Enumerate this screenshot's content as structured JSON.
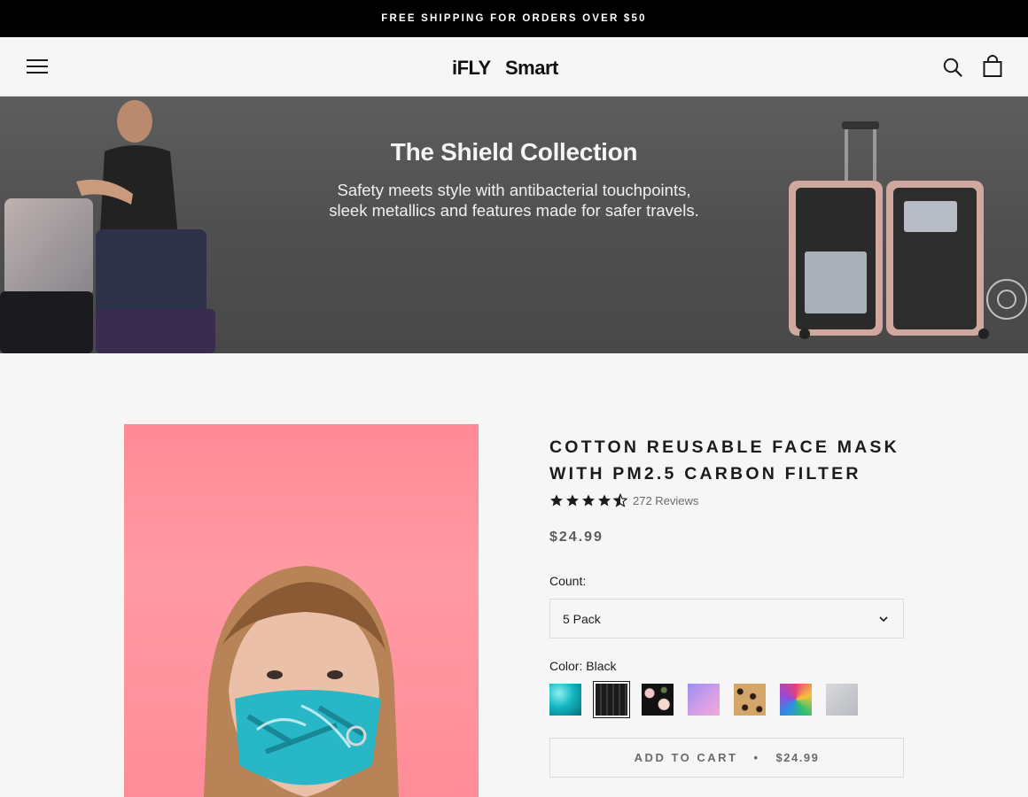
{
  "announcement": "FREE SHIPPING FOR ORDERS OVER $50",
  "brand": {
    "logo_text": "iFLYSmart"
  },
  "hero": {
    "title": "The Shield Collection",
    "subtitle_line1": "Safety meets style with antibacterial touchpoints,",
    "subtitle_line2": "sleek metallics and features made for safer travels."
  },
  "product": {
    "title": "COTTON REUSABLE FACE MASK WITH PM2.5 CARBON FILTER",
    "rating": 4.5,
    "reviews_label": "272 Reviews",
    "price": "$24.99",
    "count_label": "Count:",
    "count_value": "5 Pack",
    "color_label": "Color:",
    "color_value": "Black",
    "swatches": [
      {
        "name": "turquoise",
        "color": "#18c1c9",
        "selected": false
      },
      {
        "name": "black",
        "color": "#1f1f1f",
        "selected": true
      },
      {
        "name": "floral",
        "color": "#151515",
        "selected": false
      },
      {
        "name": "lavender",
        "color": "#b48ce6",
        "selected": false
      },
      {
        "name": "leopard",
        "color": "#c69a5f",
        "selected": false
      },
      {
        "name": "tie-dye",
        "color": "#e8407a",
        "selected": false
      },
      {
        "name": "silver",
        "color": "#c6c8cc",
        "selected": false
      }
    ],
    "add_to_cart_label": "ADD TO CART",
    "add_to_cart_sep": "•",
    "add_to_cart_price": "$24.99"
  }
}
